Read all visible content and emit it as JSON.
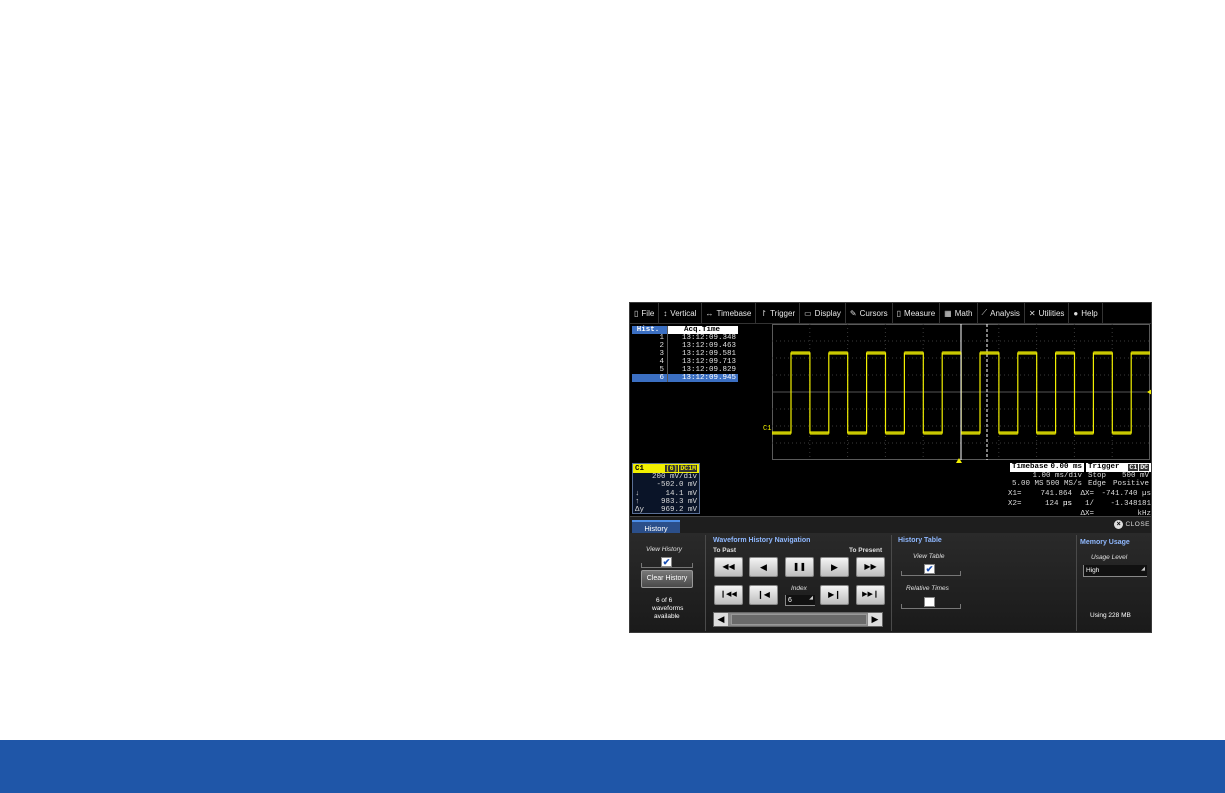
{
  "menu": {
    "items": [
      {
        "label": "File",
        "icon": "file-icon",
        "glyph": "▯"
      },
      {
        "label": "Vertical",
        "icon": "vertical-arrows-icon",
        "glyph": "↕"
      },
      {
        "label": "Timebase",
        "icon": "horizontal-arrows-icon",
        "glyph": "↔"
      },
      {
        "label": "Trigger",
        "icon": "trigger-icon",
        "glyph": "↾"
      },
      {
        "label": "Display",
        "icon": "display-icon",
        "glyph": "▭"
      },
      {
        "label": "Cursors",
        "icon": "cursors-icon",
        "glyph": "✎"
      },
      {
        "label": "Measure",
        "icon": "measure-icon",
        "glyph": "▯"
      },
      {
        "label": "Math",
        "icon": "math-icon",
        "glyph": "▦"
      },
      {
        "label": "Analysis",
        "icon": "analysis-icon",
        "glyph": "⟋"
      },
      {
        "label": "Utilities",
        "icon": "utilities-icon",
        "glyph": "✕"
      },
      {
        "label": "Help",
        "icon": "help-icon",
        "glyph": "●"
      }
    ]
  },
  "history_table": {
    "col_index": "Hist.",
    "col_time": "Acq.Time",
    "rows": [
      {
        "index": "1",
        "time": "13:12:09.348"
      },
      {
        "index": "2",
        "time": "13:12:09.463"
      },
      {
        "index": "3",
        "time": "13:12:09.581"
      },
      {
        "index": "4",
        "time": "13:12:09.713"
      },
      {
        "index": "5",
        "time": "13:12:09.829"
      },
      {
        "index": "6",
        "time": "13:12:09.945"
      }
    ],
    "selected_index": 5
  },
  "trace": {
    "label": "C1",
    "color": "#f2f000"
  },
  "channel": {
    "name": "C1",
    "tag1": "[6]",
    "tag2": "DC1M",
    "volts_div": "200 mV/div",
    "offset": "-502.0 mV",
    "cursor1": "14.1 mV",
    "cursor2": "983.3 mV",
    "delta": "969.2 mV",
    "cursor1_sym": "↓",
    "cursor2_sym": "↑",
    "delta_sym": "Δy"
  },
  "timebase": {
    "title": "Timebase",
    "delay": "0.00 ms",
    "time_div": "1.00 ms/div",
    "samples": "5.00 MS",
    "rate": "500 MS/s"
  },
  "trigger": {
    "title": "Trigger",
    "src": "C1",
    "coupling": "DC",
    "mode": "Stop",
    "level": "500 mV",
    "type": "Edge",
    "slope": "Positive"
  },
  "cursors": {
    "x1_label": "X1=",
    "x1_value": "741.864 µs",
    "dx_label": "ΔX=",
    "dx_value": "-741.740 µs",
    "x2_label": "X2=",
    "x2_value": "124 ns",
    "inv_label": "1/ΔX=",
    "inv_value": "-1.348181 kHz"
  },
  "dialog": {
    "tab_label": "History",
    "close_label": "CLOSE",
    "view_history_label": "View History",
    "clear_history_label": "Clear History",
    "available_count": "6 of 6",
    "available_text1": "waveforms",
    "available_text2": "available",
    "nav_title": "Waveform History Navigation",
    "to_past": "To Past",
    "to_present": "To Present",
    "index_label": "Index",
    "index_value": "6",
    "table_title": "History Table",
    "view_table_label": "View Table",
    "relative_times_label": "Relative Times",
    "memory_title": "Memory Usage",
    "usage_level_label": "Usage Level",
    "usage_level_value": "High",
    "using_text": "Using 228 MB",
    "check_mark": "✔"
  },
  "buttons": {
    "fast_rewind": "◀◀",
    "step_back": "◀",
    "pause": "❚❚",
    "play": "▶",
    "fast_forward": "▶▶",
    "to_first": "❙◀◀",
    "prev": "❙◀",
    "next": "▶❙",
    "to_last": "▶▶❙",
    "scroll_left": "◀",
    "scroll_right": "▶"
  }
}
